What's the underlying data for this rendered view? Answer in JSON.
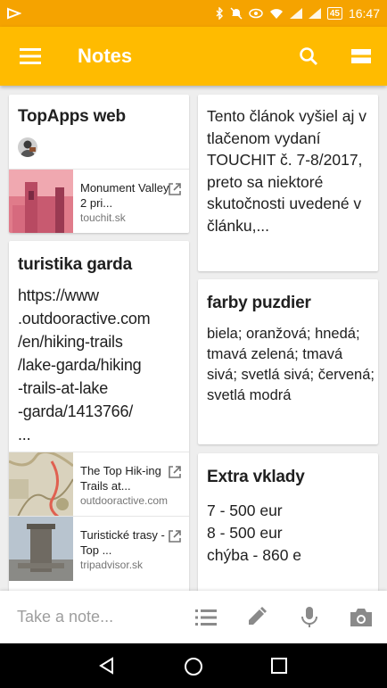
{
  "status_bar": {
    "time": "16:47",
    "battery": "45",
    "colors": {
      "background": "#f5a300"
    }
  },
  "app_bar": {
    "title": "Notes",
    "menu_icon": "hamburger-menu-icon",
    "search_icon": "search-icon",
    "view_toggle_icon": "list-view-icon",
    "colors": {
      "background": "#ffbb00",
      "text": "#ffffff"
    }
  },
  "notes": {
    "left": [
      {
        "title": "TopApps web",
        "link": {
          "title": "Monument Valley 2 pri...",
          "domain": "touchit.sk"
        }
      },
      {
        "title": "turistika garda",
        "body": "https://www\n.outdooractive.com\n/en/hiking-trails\n/lake-garda/hiking\n-trails-at-lake\n-garda/1413766/\n...",
        "links": [
          {
            "title": "The Top Hik-ing Trails at...",
            "domain": "outdooractive.com"
          },
          {
            "title": "Turistické trasy - Top ...",
            "domain": "tripadvisor.sk"
          }
        ]
      }
    ],
    "right": [
      {
        "body": "Tento článok vyšiel aj v tlačenom vydaní TOUCHIT č. 7-8/2017, preto sa niektoré skutočnosti uvedené v článku,..."
      },
      {
        "title": "farby puzdier",
        "body": "biela; oranžová; hnedá; tmavá zelená; tmavá sivá; svetlá sivá; červená; svetlá modrá"
      },
      {
        "title": "Extra vklady",
        "lines": [
          "7 - 500 eur",
          "8 - 500 eur",
          "chýba - 860 e"
        ]
      }
    ]
  },
  "bottom_bar": {
    "placeholder": "Take a note...",
    "icons": [
      "list-icon",
      "pen-icon",
      "mic-icon",
      "camera-icon"
    ]
  },
  "nav_bar": {
    "icons": [
      "back-icon",
      "home-icon",
      "recents-icon"
    ]
  }
}
